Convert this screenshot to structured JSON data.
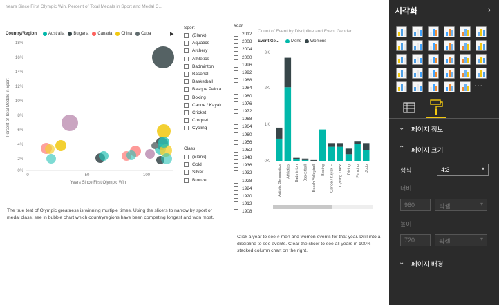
{
  "bubble": {
    "title": "Years Since First Olympic Win, Percent of Total Medals in Sport and Medal C...",
    "legend_title": "Country/Region",
    "legend": [
      {
        "name": "Australia",
        "color": "#01b8aa"
      },
      {
        "name": "Bulgaria",
        "color": "#374649"
      },
      {
        "name": "Canada",
        "color": "#fd625e"
      },
      {
        "name": "China",
        "color": "#f2c80f"
      },
      {
        "name": "Cuba",
        "color": "#5f6b6d"
      }
    ],
    "ylabel": "Percent of Total Medals in Sport",
    "xlabel": "Years Since First Olympic Win",
    "yticks": [
      "18%",
      "16%",
      "14%",
      "12%",
      "10%",
      "8%",
      "6%",
      "4%",
      "2%",
      "0%"
    ],
    "xticks": [
      "0",
      "50",
      "100"
    ]
  },
  "slicer_sport": {
    "header": "Sport",
    "items": [
      "(Blank)",
      "Aquatics",
      "Archery",
      "Athletics",
      "Badminton",
      "Baseball",
      "Basketball",
      "Basque Pelota",
      "Boxing",
      "Canoe / Kayak",
      "Cricket",
      "Croquet",
      "Cycling"
    ]
  },
  "slicer_class": {
    "header": "Class",
    "items": [
      "(Blank)",
      "Gold",
      "Silver",
      "Bronze"
    ]
  },
  "slicer_year": {
    "header": "Year",
    "items": [
      "2012",
      "2008",
      "2004",
      "2000",
      "1996",
      "1992",
      "1988",
      "1984",
      "1980",
      "1976",
      "1972",
      "1968",
      "1964",
      "1960",
      "1956",
      "1952",
      "1948",
      "1936",
      "1932",
      "1928",
      "1924",
      "1920",
      "1912",
      "1908"
    ]
  },
  "column_chart": {
    "title": "Count of Event by Discipline and Event Gender",
    "legend_title": "Event Ge...",
    "legend": [
      {
        "name": "Mens",
        "color": "#01b8aa"
      },
      {
        "name": "Womens",
        "color": "#374649"
      }
    ]
  },
  "chart_data": {
    "type": "bar",
    "title": "Count of Event by Discipline and Event Gender",
    "categories": [
      "Artistic Gymnastics",
      "Athletics",
      "Badminton",
      "Basketball",
      "Beach Volleyball",
      "Boxing",
      "Canoe / Kayak F",
      "Cycling Track",
      "Diving",
      "Fencing",
      "Judo"
    ],
    "series": [
      {
        "name": "Mens",
        "values": [
          620,
          2020,
          60,
          40,
          20,
          870,
          400,
          400,
          200,
          480,
          300
        ]
      },
      {
        "name": "Womens",
        "values": [
          300,
          800,
          40,
          40,
          20,
          0,
          100,
          100,
          150,
          60,
          200
        ]
      }
    ],
    "yticks": [
      "3K",
      "2K",
      "1K",
      "0K"
    ],
    "ylim": [
      0,
      3000
    ]
  },
  "texts": {
    "left_paragraph": "The true test of Olympic greatness is winning multiple times. Using the slicers to narrow by sport or medal class, see in bubble chart which countryregions  have been competing longest and won most.",
    "right_paragraph": "Click a year to see # men and women events for that year. Drill into a discipline to see events. Clear the slicer to see all years in 100% stacked column chart on the right."
  },
  "pane": {
    "title": "시각화",
    "more": "...",
    "sections": {
      "page_info": "페이지 정보",
      "page_size": "페이지 크기",
      "page_background": "페이지 배경"
    },
    "format_label": "형식",
    "format_value": "4:3",
    "width_label": "너비",
    "width_value": "960",
    "width_unit": "픽셀",
    "height_label": "높이",
    "height_value": "720",
    "height_unit": "픽셀"
  }
}
